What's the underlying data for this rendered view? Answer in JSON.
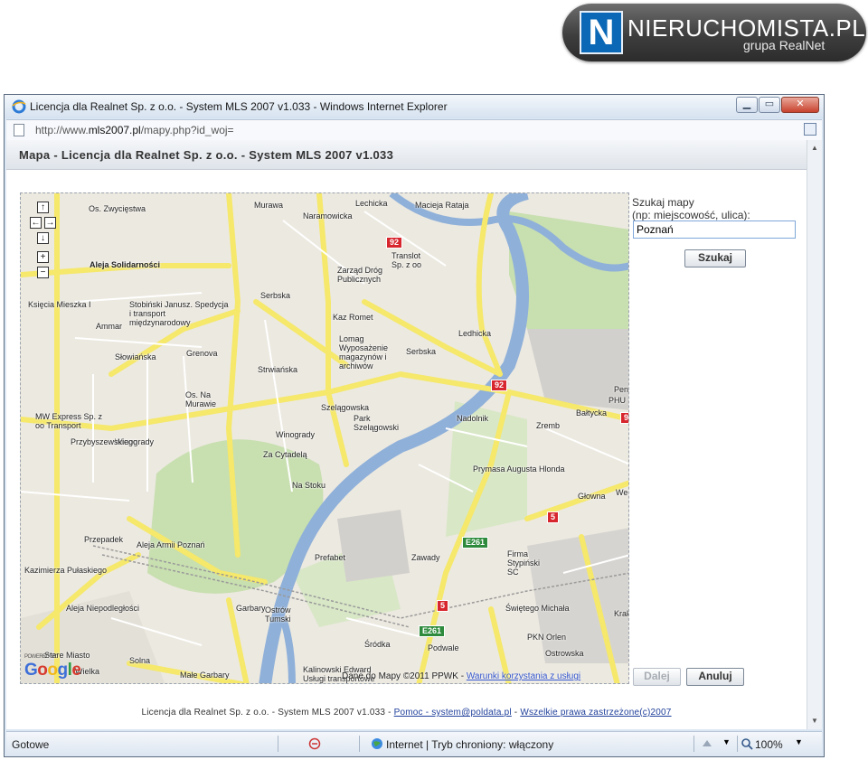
{
  "brand": {
    "mark": "N",
    "name": "NIERUCHOMISTA.PL",
    "sub": "grupa RealNet"
  },
  "window": {
    "title": "Licencja dla Realnet Sp. z o.o. - System MLS 2007 v1.033 - Windows Internet Explorer",
    "minimize_icon": "minimize-icon",
    "maximize_icon": "maximize-icon",
    "close_icon": "close-icon"
  },
  "address": {
    "prefix": "http://www.",
    "domain": "mls2007.pl",
    "path": "/mapy.php?id_woj="
  },
  "page": {
    "header": "Mapa - Licencja dla Realnet Sp. z o.o. - System MLS 2007 v1.033"
  },
  "map": {
    "labels": [
      "Os. Zwycięstwa",
      "Aleja Solidarności",
      "Murawa",
      "Naramowicka",
      "Lechicka",
      "Macieja Rataja",
      "Translot Sp. z oo",
      "Zarząd Dróg Publicznych",
      "Serbska",
      "Kaz Romet",
      "Stobiński Janusz. Spedycja i transport międzynarodowy",
      "Ammar",
      "Słowiańska",
      "Grenova",
      "Lomag Wyposażenie magazynów i archiwów",
      "Os. Na Murawie",
      "Strwiańska",
      "Serbska",
      "Ledhicka",
      "Park Szelągowski",
      "Nadolnik",
      "Zremb",
      "Bałtycka",
      "PHU",
      "Pen",
      "MW Express Sp. z oo Transport",
      "Winogrady",
      "Za Cytadelą",
      "Winogrady",
      "Szelągowska",
      "Na Stoku",
      "Przybyszewskiego",
      "Księcia Mieszka I",
      "Głowna",
      "Prymasa Augusta Hlonda",
      "Przepadek",
      "Aleja Armii Poznań",
      "Prefabet",
      "Zawady",
      "Firma Stypiński SC",
      "Kazimierza Pułaskiego",
      "Aleja Niepodległości",
      "Ostrów Tumski",
      "Garbary",
      "Śródka",
      "Podwale",
      "PKN Orlen",
      "Świętego Michała",
      "Stare Miasto",
      "Solna",
      "Małe Garbary",
      "Kalinowski Edward Usługi transportowe",
      "We",
      "Krakowska",
      "Ostrowska",
      "Wielka"
    ],
    "roads": [
      "92",
      "92",
      "5",
      "5",
      "9",
      "E261",
      "E261"
    ],
    "nav": [
      "↑",
      "←",
      "→",
      "↓",
      "+",
      "−"
    ],
    "google": "Google",
    "powered": "POWERED BY",
    "copyright": "Dane do Mapy ©2011 PPWK -",
    "terms_link": "Warunki korzystania z usługi"
  },
  "search": {
    "label_line1": "Szukaj mapy",
    "label_line2": "(np: miejscowość, ulica):",
    "value": "Poznań",
    "button": "Szukaj"
  },
  "actions": {
    "next": "Dalej",
    "cancel": "Anuluj"
  },
  "footer": {
    "license": "Licencja dla Realnet Sp. z o.o. - System MLS 2007 v1.033 -",
    "help_link": "Pomoc - system@poldata.pl",
    "sep": "-",
    "rights_link": "Wszelkie prawa zastrzeżone(c)2007"
  },
  "status": {
    "text": "Gotowe",
    "zone": "Internet | Tryb chroniony: włączony",
    "zoom": "100%"
  },
  "colors": {
    "title_bg": "#dbe6f3",
    "river": "#8fb0d9",
    "road_yellow": "#f5e86a",
    "park": "#c8dfb0"
  }
}
